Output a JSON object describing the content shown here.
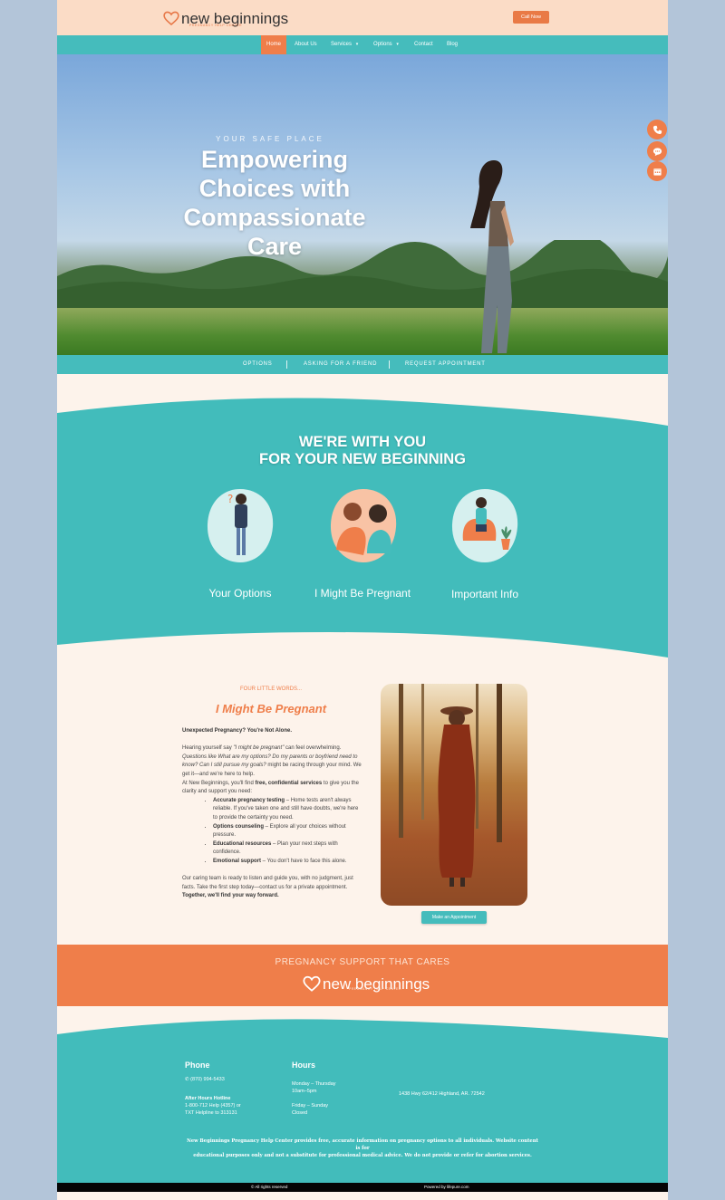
{
  "header": {
    "logo_text": "new beginnings",
    "logo_sub": "PREGNANCY HELP CENTER",
    "call_button": "Call Now"
  },
  "nav": {
    "items": [
      {
        "label": "Home",
        "active": true
      },
      {
        "label": "About Us"
      },
      {
        "label": "Services",
        "dropdown": true
      },
      {
        "label": "Options",
        "dropdown": true
      },
      {
        "label": "Contact"
      },
      {
        "label": "Blog"
      }
    ]
  },
  "hero": {
    "eyebrow": "YOUR SAFE PLACE",
    "title_line1": "Empowering",
    "title_line2": "Choices with",
    "title_line3": "Compassionate",
    "title_line4": "Care"
  },
  "floating": {
    "icons": [
      "phone-icon",
      "chat-icon",
      "calendar-icon"
    ]
  },
  "subbar": {
    "items": [
      "OPTIONS",
      "ASKING FOR A FRIEND",
      "REQUEST APPOINTMENT"
    ]
  },
  "teal_section": {
    "title_line1": "WE'RE WITH YOU",
    "title_line2": "FOR YOUR NEW BEGINNING",
    "cards": [
      {
        "label": "Your Options"
      },
      {
        "label": "I Might Be Pregnant"
      },
      {
        "label": "Important Info"
      }
    ]
  },
  "content": {
    "eyebrow": "FOUR LITTLE WORDS...",
    "heading": "I Might Be Pregnant",
    "intro_bold": "Unexpected Pregnancy? You're Not Alone.",
    "para1_a": "Hearing yourself say ",
    "para1_quote": "\"I might be pregnant\"",
    "para1_b": " can feel overwhelming. ",
    "para1_q": "Questions like What are my options? Do my parents or boyfriend need to know? Can I still pursue my goals?",
    "para1_c": " might be racing through your mind. We get it—and we're here to help.",
    "para2_a": "At New Beginnings, you'll find ",
    "para2_bold": "free, confidential services",
    "para2_b": " to give you the clarity and support you need:",
    "bullets": [
      {
        "bold": "Accurate pregnancy testing",
        "text": " – Home tests aren't always reliable. If you've taken one and still have doubts, we're here to provide the certainty you need."
      },
      {
        "bold": "Options counseling",
        "text": " – Explore all your choices without pressure."
      },
      {
        "bold": "Educational resources",
        "text": " – Plan your next steps with confidence."
      },
      {
        "bold": "Emotional support",
        "text": " – You don't have to face this alone."
      }
    ],
    "para3": "Our caring team is ready to listen and guide you, with no judgment, just facts. Take the first step today—contact us for a private appointment.",
    "closing_bold": "Together, we'll find your way forward.",
    "appointment_button": "Make an Appointment"
  },
  "banner": {
    "title": "PREGNANCY SUPPORT THAT CARES",
    "logo_text": "new beginnings",
    "logo_sub": "PREGNANCY HELP CENTER"
  },
  "footer": {
    "phone_heading": "Phone",
    "phone": "(870) 994-5433",
    "after_hours_label": "After Hours Hotline",
    "after_hours_line1": "1-800-712 Help (4357) or",
    "after_hours_line2": "TXT Helpline to 313131",
    "hours_heading": "Hours",
    "hours_line1": "Monday – Thursday",
    "hours_line2": "10am–5pm",
    "hours_line3": "Friday – Sunday",
    "hours_line4": "Closed",
    "address": "1438 Hwy 62/412 Highland, AR. 72542",
    "disclaimer_line1": "New Beginnings Pregnancy Help Center provides free, accurate information on pregnancy options to all individuals. Website content is for",
    "disclaimer_line2": "educational purposes only and not a substitute for professional medical advice. We do not provide or refer for abortion services.",
    "copyright": "© All rights reserved",
    "powered": "Powered by lifepure.com"
  },
  "colors": {
    "teal": "#45bcbc",
    "orange": "#ef7e4a",
    "peach": "#fbdcc6",
    "cream": "#fdf3eb"
  }
}
